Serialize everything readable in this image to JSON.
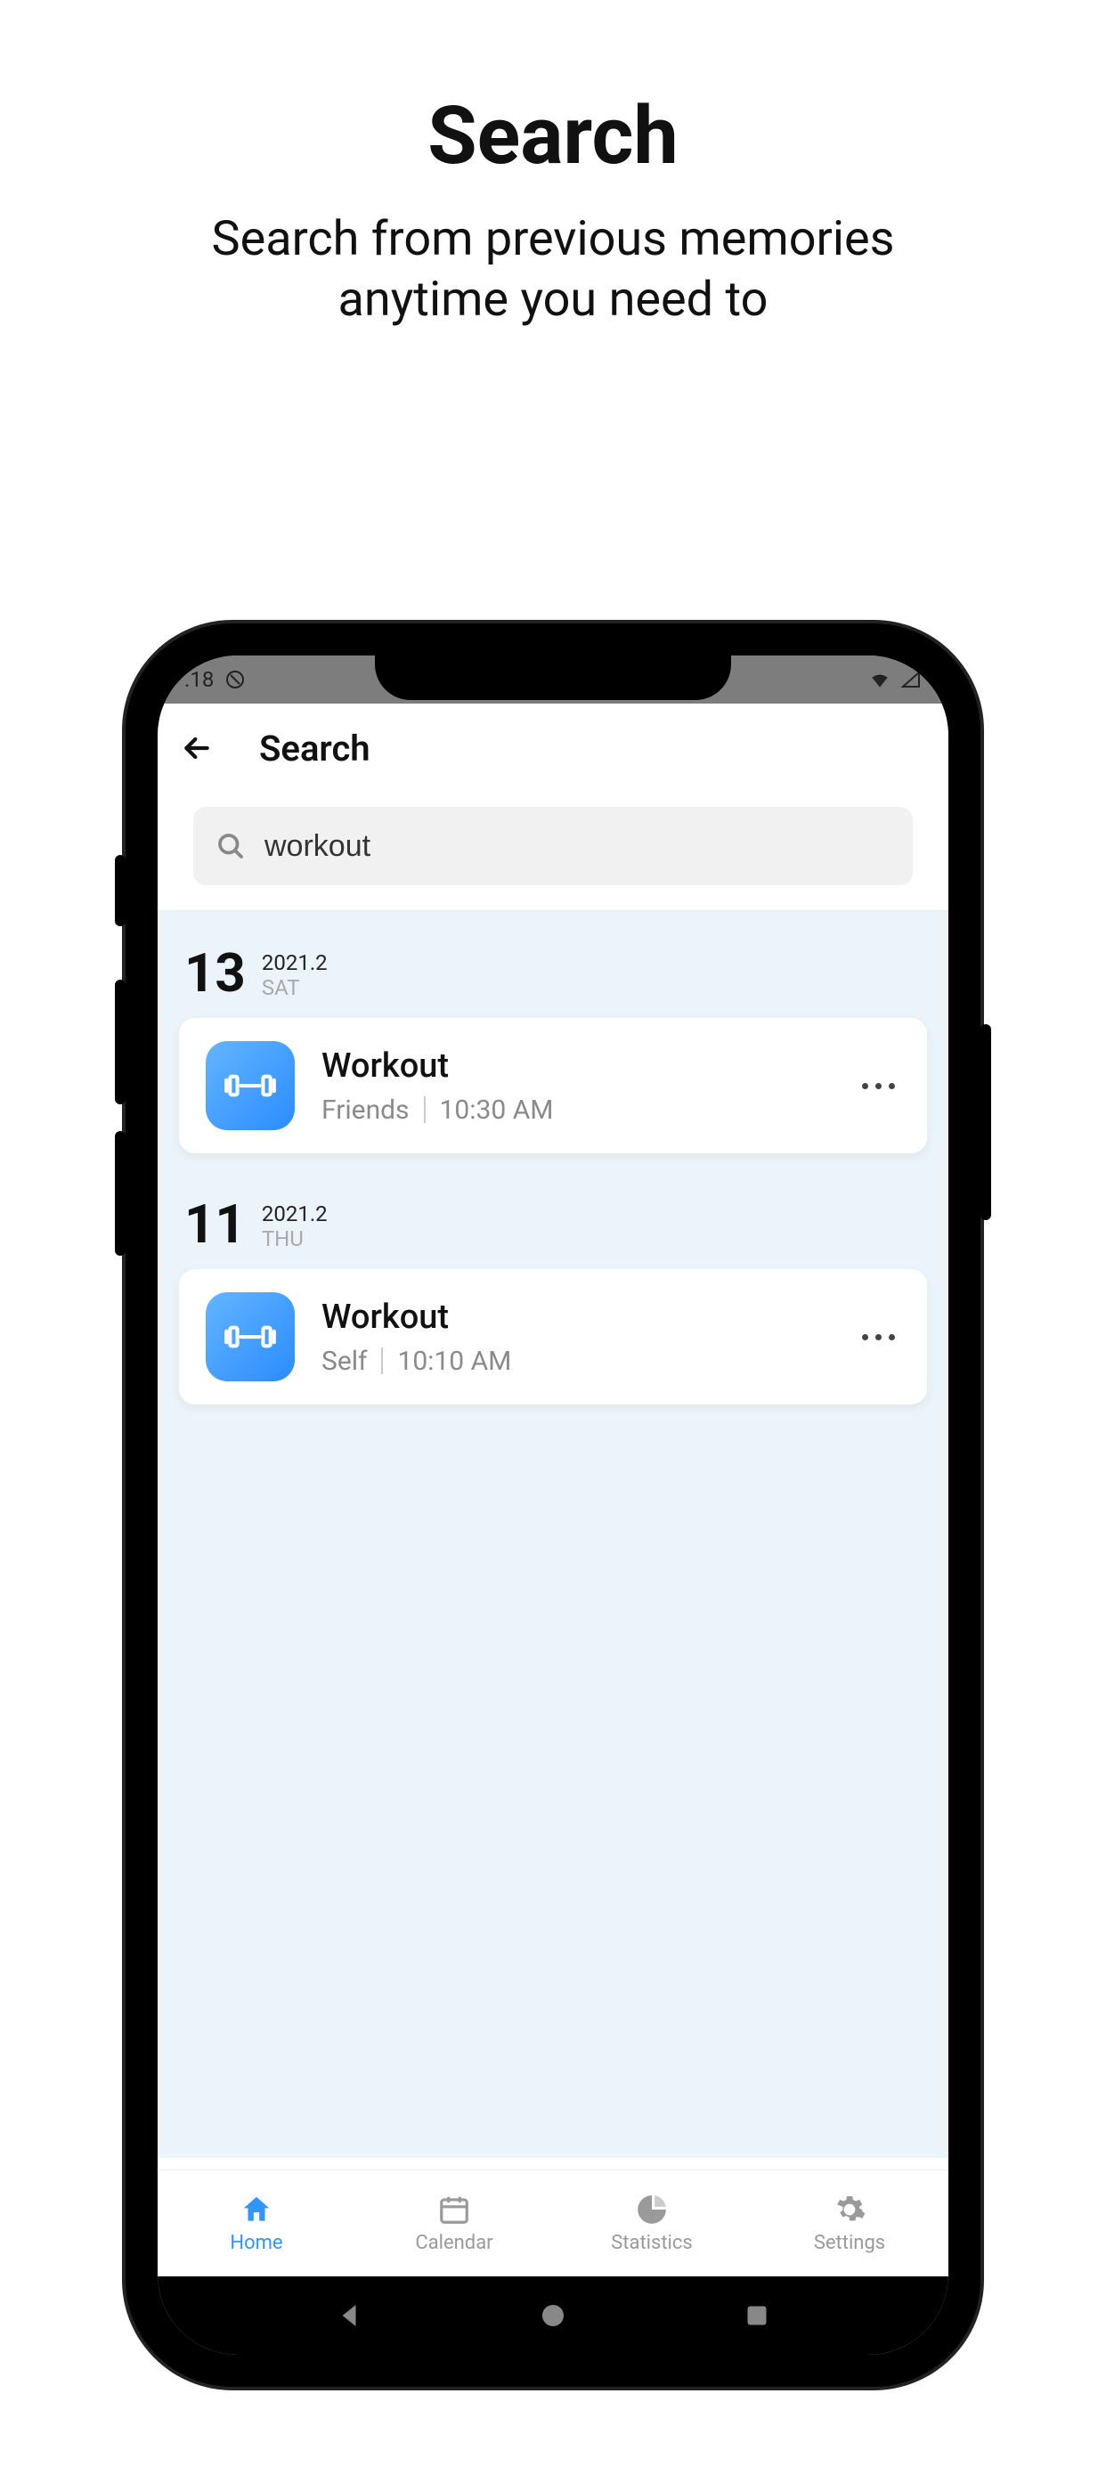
{
  "promo": {
    "title": "Search",
    "subtitle_l1": "Search from previous memories",
    "subtitle_l2": "anytime you need to"
  },
  "status": {
    "time_fragment": ".18"
  },
  "header": {
    "title": "Search"
  },
  "search": {
    "value": "workout"
  },
  "results": [
    {
      "day": "13",
      "year_month": "2021.2",
      "dow": "SAT",
      "title": "Workout",
      "category": "Friends",
      "time": "10:30 AM"
    },
    {
      "day": "11",
      "year_month": "2021.2",
      "dow": "THU",
      "title": "Workout",
      "category": "Self",
      "time": "10:10 AM"
    }
  ],
  "nav": {
    "home": "Home",
    "calendar": "Calendar",
    "statistics": "Statistics",
    "settings": "Settings"
  }
}
